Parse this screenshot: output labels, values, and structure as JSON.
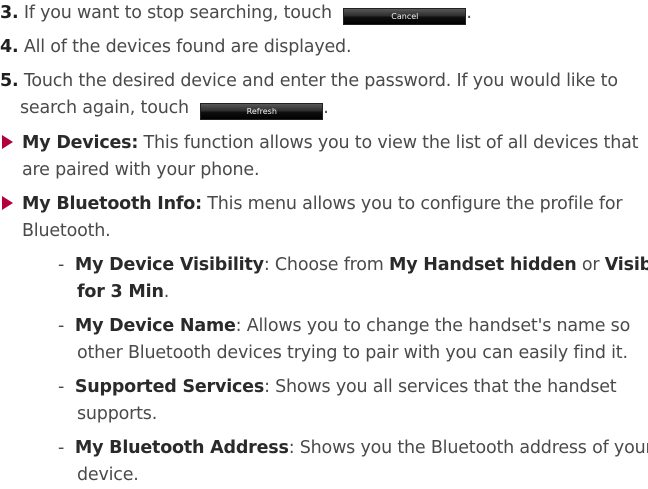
{
  "steps": [
    {
      "number": "3.",
      "text": "If you want to stop searching, touch",
      "button": "Cancel",
      "after": "."
    },
    {
      "number": "4.",
      "text": "All of the devices found are displayed."
    },
    {
      "number": "5.",
      "line1": "Touch the desired device and enter the password. If you would like to",
      "line2": "search again, touch",
      "button": "Refresh",
      "after": "."
    }
  ],
  "bullets": [
    {
      "title": "My Devices:",
      "line1": " This function allows you to view the list of all devices that",
      "line2": "are paired with your phone."
    },
    {
      "title": "My Bluetooth Info:",
      "line1": " This menu allows you to configure the profile for",
      "line2": "Bluetooth."
    }
  ],
  "subitems": [
    {
      "dash": "-",
      "title": "My Device Visibility",
      "text1": ": Choose from ",
      "bold1": "My Handset hidden",
      "text2": " or ",
      "bold2": "Visible",
      "line2_bold": "for 3 Min",
      "line2_end": "."
    },
    {
      "dash": "-",
      "title": "My Device Name",
      "line1": ": Allows you to change the handset's name so",
      "line2": "other Bluetooth devices trying to pair with you can easily find it."
    },
    {
      "dash": "-",
      "title": "Supported Services",
      "line1": ": Shows you all services that the handset",
      "line2": "supports."
    },
    {
      "dash": "-",
      "title": "My Bluetooth Address",
      "line1": ": Shows you the Bluetooth address of your",
      "line2": "device."
    }
  ],
  "colors": {
    "bullet_triangle": "#b3003c",
    "text": "#4a4a4a"
  }
}
